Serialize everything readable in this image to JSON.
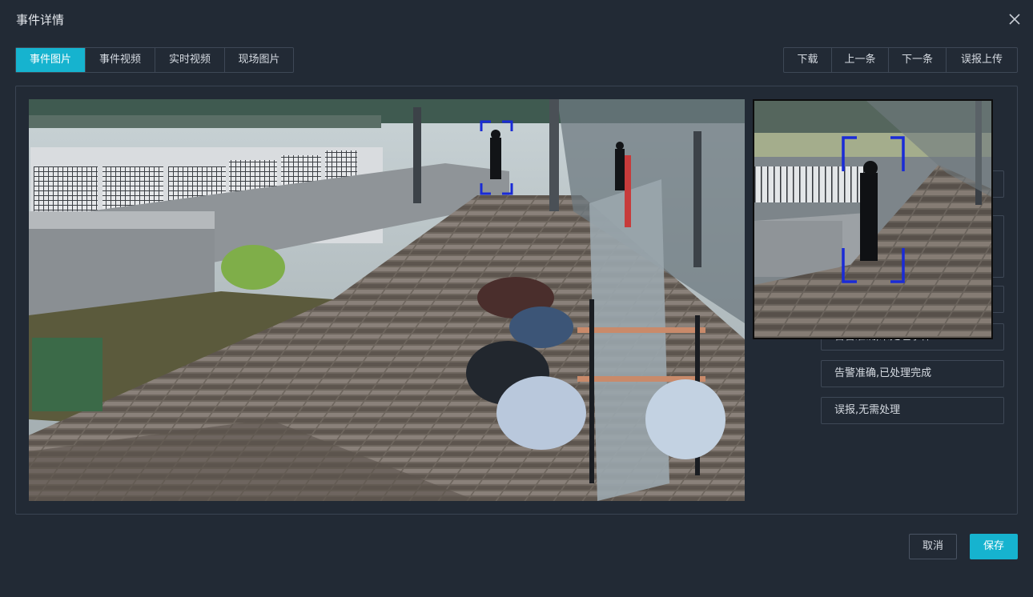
{
  "dialog": {
    "title": "事件详情"
  },
  "tabs": [
    {
      "label": "事件图片",
      "active": true
    },
    {
      "label": "事件视频",
      "active": false
    },
    {
      "label": "实时视频",
      "active": false
    },
    {
      "label": "现场图片",
      "active": false
    }
  ],
  "actions": [
    "下载",
    "上一条",
    "下一条",
    "误报上传"
  ],
  "disposition_options": [
    "告警准确,未处理事件",
    "告警准确,已处理完成",
    "误报,无需处理"
  ],
  "footer": {
    "cancel_label": "取消",
    "save_label": "保存"
  },
  "colors": {
    "accent": "#16b3cf",
    "background": "#222a35",
    "detection_box": "#1a2bd6"
  },
  "icons": {
    "close": "close-icon"
  }
}
